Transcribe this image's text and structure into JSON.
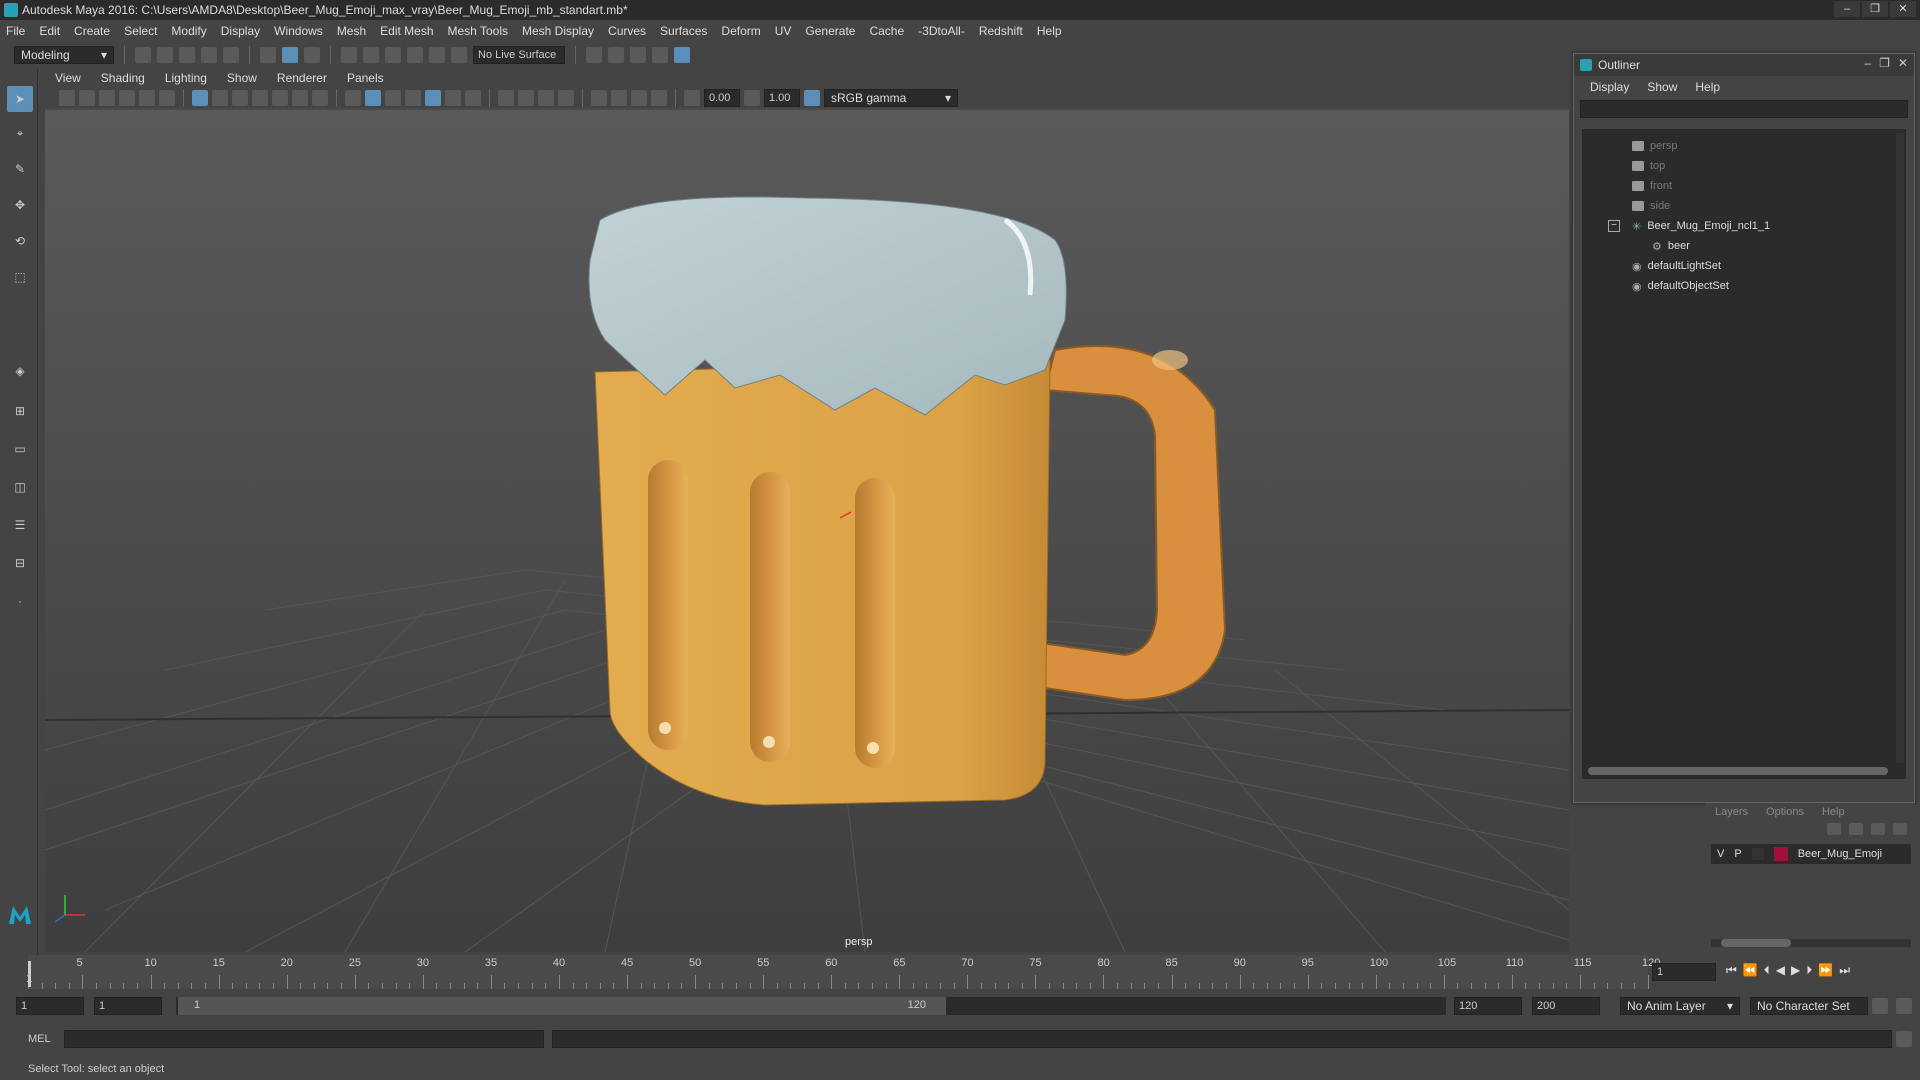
{
  "window": {
    "title": "Autodesk Maya 2016: C:\\Users\\AMDA8\\Desktop\\Beer_Mug_Emoji_max_vray\\Beer_Mug_Emoji_mb_standart.mb*"
  },
  "menubar": [
    "File",
    "Edit",
    "Create",
    "Select",
    "Modify",
    "Display",
    "Windows",
    "Mesh",
    "Edit Mesh",
    "Mesh Tools",
    "Mesh Display",
    "Curves",
    "Surfaces",
    "Deform",
    "UV",
    "Generate",
    "Cache",
    "-3DtoAll-",
    "Redshift",
    "Help"
  ],
  "statusline": {
    "mode": "Modeling",
    "live_surface": "No Live Surface"
  },
  "viewport": {
    "menus": [
      "View",
      "Shading",
      "Lighting",
      "Show",
      "Renderer",
      "Panels"
    ],
    "exposure": "0.00",
    "gamma": "1.00",
    "color_space": "sRGB gamma",
    "camera_label": "persp"
  },
  "outliner": {
    "title": "Outliner",
    "menus": [
      "Display",
      "Show",
      "Help"
    ],
    "items": [
      {
        "label": "persp",
        "dim": true
      },
      {
        "label": "top",
        "dim": true
      },
      {
        "label": "front",
        "dim": true
      },
      {
        "label": "side",
        "dim": true
      },
      {
        "label": "Beer_Mug_Emoji_ncl1_1",
        "dim": false
      },
      {
        "label": "beer",
        "dim": false
      },
      {
        "label": "defaultLightSet",
        "dim": false
      },
      {
        "label": "defaultObjectSet",
        "dim": false
      }
    ]
  },
  "layers": {
    "tabs": [
      "Layers",
      "Options",
      "Help"
    ],
    "layer_v": "V",
    "layer_p": "P",
    "layer_name": "Beer_Mug_Emoji",
    "layer_color": "#a0103a"
  },
  "timeline": {
    "ticks": [
      "5",
      "10",
      "15",
      "20",
      "25",
      "30",
      "35",
      "40",
      "45",
      "50",
      "55",
      "60",
      "65",
      "70",
      "75",
      "80",
      "85",
      "90",
      "95",
      "100",
      "105",
      "110",
      "115",
      "120"
    ],
    "first": "1",
    "current_frame": "1"
  },
  "range": {
    "start": "1",
    "anim_start": "1",
    "slider_start": "1",
    "slider_end": "120",
    "end": "120",
    "anim_end": "200",
    "anim_layer": "No Anim Layer",
    "character_set": "No Character Set"
  },
  "command": {
    "label": "MEL"
  },
  "help": {
    "text": "Select Tool: select an object"
  },
  "colors": {
    "foam": "#b4c8cc",
    "beer": "#dca246",
    "handle": "#d98f3e"
  }
}
